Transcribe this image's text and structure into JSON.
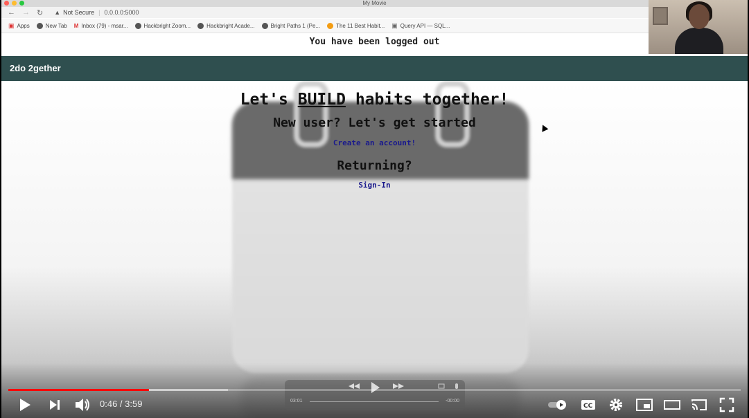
{
  "window": {
    "title": "My Movie"
  },
  "browser": {
    "security": "Not Secure",
    "url": "0.0.0.0:5000",
    "bookmarks": [
      "Apps",
      "New Tab",
      "Inbox (79) - msar...",
      "Hackbright Zoom...",
      "Hackbright Acade...",
      "Bright Paths 1 (Pe...",
      "The 11 Best Habit...",
      "Query API — SQL..."
    ]
  },
  "page": {
    "flash_message": "You have been logged out",
    "brand": "2do 2gether",
    "headline_pre": "Let's ",
    "headline_emph": "BUILD",
    "headline_post": " habits together!",
    "new_user_heading": "New user? Let's get started",
    "create_account_link": "Create an account!",
    "returning_heading": "Returning?",
    "sign_in_link": "Sign-In"
  },
  "player": {
    "current_time": "0:46",
    "duration": "3:59",
    "time_display": "0:46 / 3:59",
    "progress_fraction": 0.192,
    "buffered_fraction": 0.3,
    "overlay_elapsed": "03:01",
    "overlay_remaining": "-00:00"
  },
  "colors": {
    "navbar": "#2f4f4f",
    "link": "#1a1a8c",
    "progress": "#ff0000"
  }
}
